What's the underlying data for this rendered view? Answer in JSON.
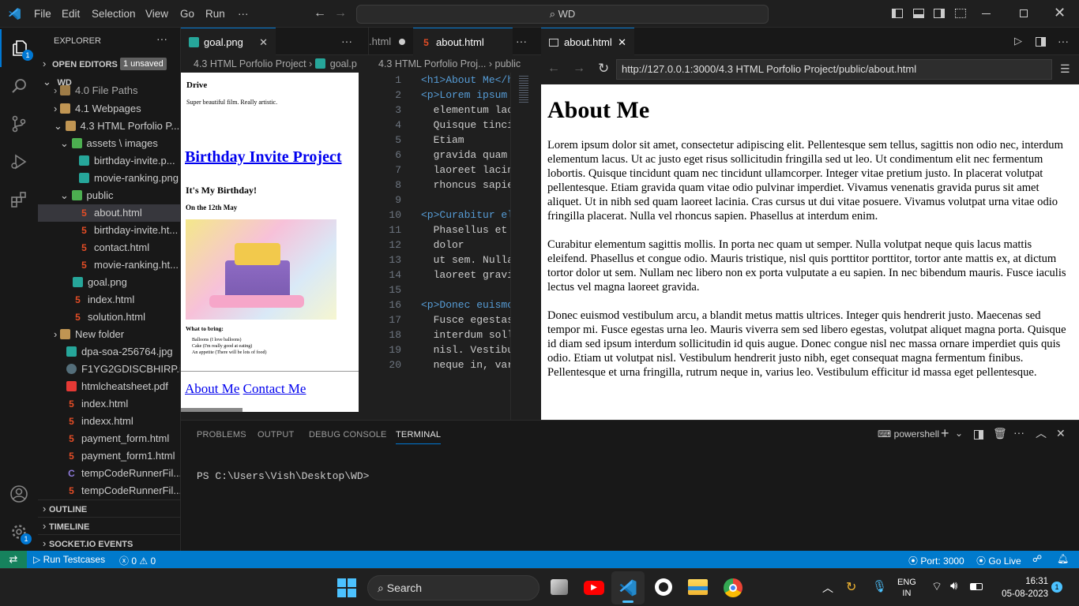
{
  "titlebar": {
    "menus": [
      "File",
      "Edit",
      "Selection",
      "View",
      "Go",
      "Run",
      "···"
    ],
    "search": "WD"
  },
  "activity": {
    "badge": "1"
  },
  "sidebar": {
    "title": "EXPLORER",
    "open_editors": "OPEN EDITORS",
    "unsaved": "1 unsaved",
    "root": "WD",
    "items": [
      "4.0 File Paths",
      "4.1 Webpages",
      "4.3 HTML Porfolio P...",
      "assets \\ images",
      "birthday-invite.p...",
      "movie-ranking.png",
      "public",
      "about.html",
      "birthday-invite.ht...",
      "contact.html",
      "movie-ranking.ht...",
      "goal.png",
      "index.html",
      "solution.html",
      "New folder",
      "dpa-soa-256764.jpg",
      "F1YG2GDISCBHIRP.i...",
      "htmlcheatsheet.pdf",
      "index.html",
      "indexx.html",
      "payment_form.html",
      "payment_form1.html",
      "tempCodeRunnerFil...",
      "tempCodeRunnerFil..."
    ],
    "outline": "OUTLINE",
    "timeline": "TIMELINE",
    "socketio": "SOCKET.IO EVENTS"
  },
  "group1": {
    "tab": "goal.png",
    "crumb1": "4.3 HTML Porfolio Project",
    "crumb2": "goal.p"
  },
  "goal_preview": {
    "drive": "Drive",
    "drive_desc": "Super beautiful film. Really artistic.",
    "heading": "Birthday Invite Project",
    "h2": "It's My Birthday!",
    "h3": "On the 12th May",
    "bring": "What to bring:",
    "list": [
      "Balloons (I love balloons)",
      "Cake (I'm really good at eating)",
      "An appetite (There will be lots of food)"
    ],
    "links": [
      "About Me",
      "Contact Me"
    ]
  },
  "group2": {
    "tab1": ".html",
    "tab2": "about.html",
    "crumb1": "4.3 HTML Porfolio Proj...",
    "crumb2": "public"
  },
  "code_lines": [
    {
      "n": "1",
      "t": "<h1>About Me</h"
    },
    {
      "n": "2",
      "t": "<p>Lorem ipsum"
    },
    {
      "n": "3",
      "t": "  elementum lac"
    },
    {
      "n": "4",
      "t": "  Quisque tinci"
    },
    {
      "n": "5",
      "t": "  Etiam"
    },
    {
      "n": "6",
      "t": "  gravida quam"
    },
    {
      "n": "7",
      "t": "  laoreet lacin"
    },
    {
      "n": "8",
      "t": "  rhoncus sapie"
    },
    {
      "n": "9",
      "t": ""
    },
    {
      "n": "10",
      "t": "<p>Curabitur el"
    },
    {
      "n": "11",
      "t": "  Phasellus et"
    },
    {
      "n": "12",
      "t": "  dolor"
    },
    {
      "n": "13",
      "t": "  ut sem. Nulla"
    },
    {
      "n": "14",
      "t": "  laoreet gravi"
    },
    {
      "n": "15",
      "t": ""
    },
    {
      "n": "16",
      "t": "<p>Donec euismo"
    },
    {
      "n": "17",
      "t": "  Fusce egestas"
    },
    {
      "n": "18",
      "t": "  interdum soll"
    },
    {
      "n": "19",
      "t": "  nisl. Vestibu"
    },
    {
      "n": "20",
      "t": "  neque in, var"
    }
  ],
  "browser": {
    "tab": "about.html",
    "url": "http://127.0.0.1:3000/4.3 HTML Porfolio Project/public/about.html",
    "h1": "About Me",
    "p1": "Lorem ipsum dolor sit amet, consectetur adipiscing elit. Pellentesque sem tellus, sagittis non odio nec, interdum elementum lacus. Ut ac justo eget risus sollicitudin fringilla sed ut leo. Ut condimentum elit nec fermentum lobortis. Quisque tincidunt quam nec tincidunt ullamcorper. Integer vitae pretium justo. In placerat volutpat pellentesque. Etiam gravida quam vitae odio pulvinar imperdiet. Vivamus venenatis gravida purus sit amet aliquet. Ut in nibh sed quam laoreet lacinia. Cras cursus ut dui vitae posuere. Vivamus volutpat urna vitae odio fringilla placerat. Nulla vel rhoncus sapien. Phasellus at interdum enim.",
    "p2": "Curabitur elementum sagittis mollis. In porta nec quam ut semper. Nulla volutpat neque quis lacus mattis eleifend. Phasellus et congue odio. Mauris tristique, nisl quis porttitor porttitor, tortor ante mattis ex, at dictum tortor dolor ut sem. Nullam nec libero non ex porta vulputate a eu sapien. In nec bibendum mauris. Fusce iaculis lectus vel magna laoreet gravida.",
    "p3": "Donec euismod vestibulum arcu, a blandit metus mattis ultrices. Integer quis hendrerit justo. Maecenas sed tempor mi. Fusce egestas urna leo. Mauris viverra sem sed libero egestas, volutpat aliquet magna porta. Quisque id diam sed ipsum interdum sollicitudin id quis augue. Donec congue nisl nec massa ornare imperdiet quis quis odio. Etiam ut volutpat nisl. Vestibulum hendrerit justo nibh, eget consequat magna fermentum finibus. Pellentesque et urna fringilla, rutrum neque in, varius leo. Vestibulum efficitur id massa eget pellentesque."
  },
  "panel": {
    "tabs": [
      "PROBLEMS",
      "OUTPUT",
      "DEBUG CONSOLE",
      "TERMINAL"
    ],
    "shell": "powershell",
    "prompt": "PS C:\\Users\\Vish\\Desktop\\WD>"
  },
  "status": {
    "run": "Run Testcases",
    "errors": "0",
    "warnings": "0",
    "port": "Port: 3000",
    "golive": "Go Live"
  },
  "taskbar": {
    "search": "Search",
    "lang1": "ENG",
    "lang2": "IN",
    "time": "16:31",
    "date": "05-08-2023",
    "notif": "1"
  },
  "colors": {
    "accent": "#007acc",
    "html_icon": "#e44d26",
    "link": "#0000ee"
  }
}
